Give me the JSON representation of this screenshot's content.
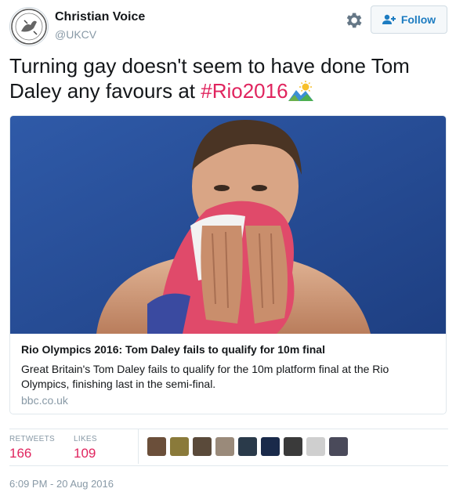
{
  "author": {
    "name": "Christian Voice",
    "handle": "@UKCV",
    "avatar_icon": "christian-voice-logo-icon"
  },
  "actions": {
    "settings_icon": "gear-icon",
    "follow_label": "Follow",
    "follow_icon": "add-user-icon"
  },
  "tweet": {
    "text": "Turning gay doesn't seem to have done Tom Daley any favours at ",
    "hashtag": "#Rio2016",
    "emoji_icon": "sunrise-mountains-emoji-icon"
  },
  "card": {
    "image_icon": "tom-daley-photo",
    "title": "Rio Olympics 2016: Tom Daley fails to qualify for 10m final",
    "description": "Great Britain's Tom Daley fails to qualify for the 10m platform final at the Rio Olympics, finishing last in the semi-final.",
    "domain": "bbc.co.uk"
  },
  "stats": {
    "retweets_label": "RETWEETS",
    "retweets_value": "166",
    "likes_label": "LIKES",
    "likes_value": "109",
    "liker_avatars": [
      "#6b4f3a",
      "#8a7a3a",
      "#5a4a3a",
      "#9a8a7a",
      "#2a3a4a",
      "#1a2a4a",
      "#3a3a3a",
      "#cfcfcf",
      "#4a4a5a"
    ]
  },
  "timestamp": "6:09 PM - 20 Aug 2016",
  "colors": {
    "hashtag": "#e0245e",
    "follow_text": "#1d7cc1",
    "muted": "#8899a6",
    "stat_value": "#e0245e"
  }
}
